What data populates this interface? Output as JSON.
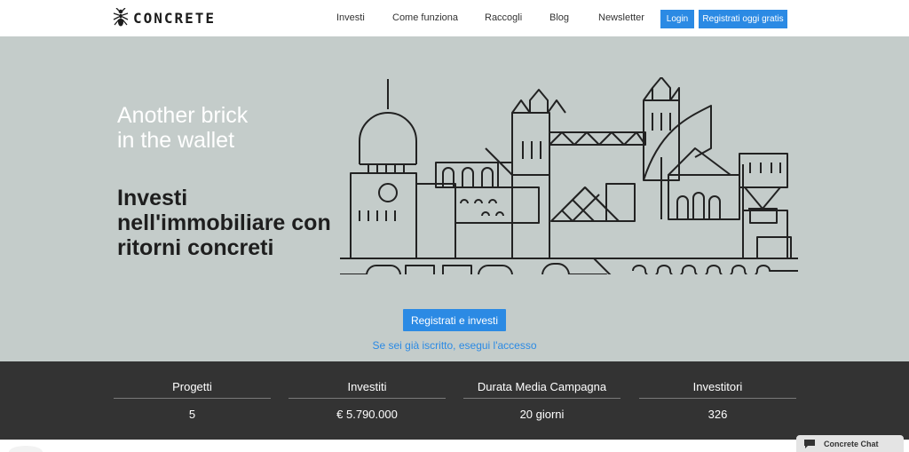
{
  "header": {
    "brand": "CONCRETE",
    "nav": [
      "Investi",
      "Come funziona",
      "Raccogli",
      "Blog",
      "Newsletter"
    ],
    "login_label": "Login",
    "register_label": "Registrati oggi gratis"
  },
  "hero": {
    "tagline": [
      "Another brick",
      "in the wallet"
    ],
    "headline": [
      "Investi",
      "nell'immobiliare con",
      "ritorni concreti"
    ],
    "cta_label": "Registrati e investi",
    "login_prompt": "Se sei già iscritto, esegui l'accesso"
  },
  "stats": [
    {
      "label": "Progetti",
      "value": "5"
    },
    {
      "label": "Investiti",
      "value": "€ 5.790.000"
    },
    {
      "label": "Durata Media Campagna",
      "value": "20 giorni"
    },
    {
      "label": "Investitori",
      "value": "326"
    }
  ],
  "chat": {
    "label": "Concrete Chat"
  },
  "colors": {
    "accent": "#2b8ae4",
    "hero_bg": "#c4ccca",
    "stats_bg": "#333333"
  }
}
